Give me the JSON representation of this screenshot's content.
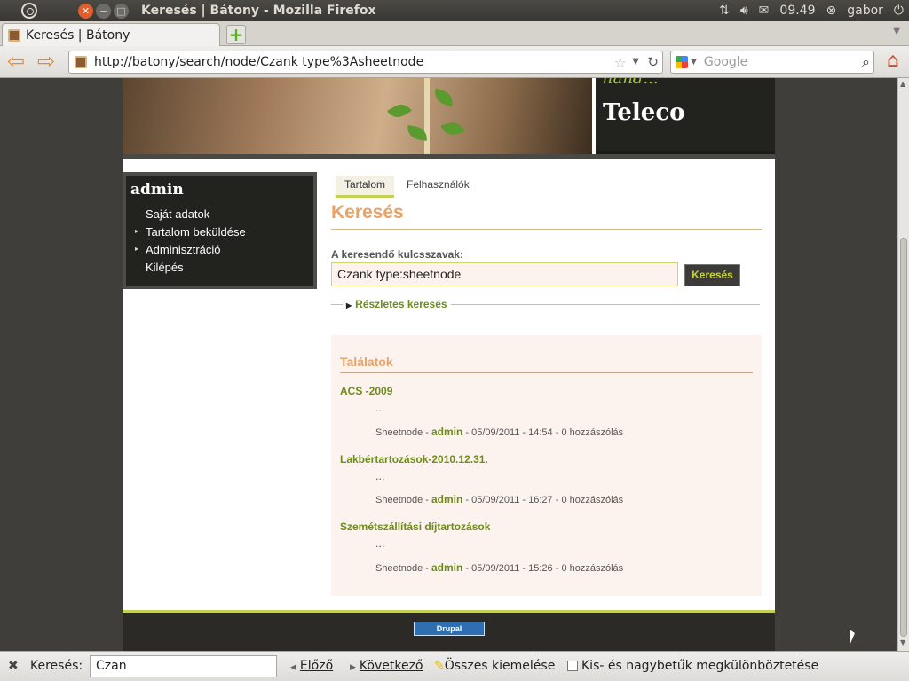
{
  "os_panel": {
    "window_title": "Keresés | Bátony - Mozilla Firefox",
    "clock": "09.49",
    "user": "gabor"
  },
  "browser": {
    "tab_label": "Keresés | Bátony",
    "url": "http://batony/search/node/Czank type%3Asheetnode",
    "search_placeholder": "Google"
  },
  "site": {
    "header_text_fragment": "hand...",
    "site_name": "Teleco"
  },
  "sidebar": {
    "title": "admin",
    "items": [
      {
        "label": "Saját adatok"
      },
      {
        "label": "Tartalom beküldése"
      },
      {
        "label": "Adminisztráció"
      },
      {
        "label": "Kilépés"
      }
    ]
  },
  "main": {
    "tabs": [
      {
        "label": "Tartalom"
      },
      {
        "label": "Felhasználók"
      }
    ],
    "title": "Keresés",
    "keyword_label": "A keresendő kulcsszavak:",
    "keyword_value": "Czank type:sheetnode",
    "search_button": "Keresés",
    "advanced_search": "Részletes keresés"
  },
  "results": {
    "title": "Találatok",
    "items": [
      {
        "title": "ACS -2009",
        "snippet": "...",
        "type": "Sheetnode -",
        "author": "admin",
        "meta": "- 05/09/2011 - 14:54 - 0 hozzászólás"
      },
      {
        "title": "Lakbértartozások-2010.12.31.",
        "snippet": "...",
        "type": "Sheetnode -",
        "author": "admin",
        "meta": "- 05/09/2011 - 16:27 - 0 hozzászólás"
      },
      {
        "title": "Szemétszállítási díjtartozások",
        "snippet": "...",
        "type": "Sheetnode -",
        "author": "admin",
        "meta": "- 05/09/2011 - 15:26 - 0 hozzászólás"
      }
    ]
  },
  "footer": {
    "badge": "Drupal"
  },
  "findbar": {
    "label": "Keresés:",
    "value": "Czan",
    "prev": "Előző",
    "next": "Következő",
    "highlight_all": "Összes kiemelése",
    "match_case": "Kis- és nagybetűk megkülönböztetése"
  }
}
